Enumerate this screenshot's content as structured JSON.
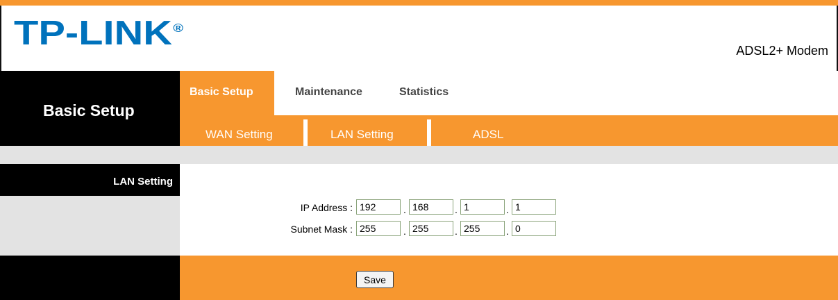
{
  "header": {
    "logo_text": "TP-LINK",
    "logo_mark": "®",
    "product_name": "ADSL2+ Modem"
  },
  "nav": {
    "section_title": "Basic Setup",
    "tabs": [
      {
        "label": "Basic Setup",
        "active": true
      },
      {
        "label": "Maintenance",
        "active": false
      },
      {
        "label": "Statistics",
        "active": false
      }
    ],
    "subnav": [
      {
        "label": "WAN Setting"
      },
      {
        "label": "LAN Setting"
      },
      {
        "label": "ADSL"
      }
    ]
  },
  "content": {
    "section_label": "LAN Setting",
    "ip_address": {
      "label": "IP Address :",
      "octets": [
        "192",
        "168",
        "1",
        "1"
      ]
    },
    "subnet_mask": {
      "label": "Subnet Mask :",
      "octets": [
        "255",
        "255",
        "255",
        "0"
      ]
    },
    "separator": "."
  },
  "footer": {
    "save_label": "Save"
  },
  "colors": {
    "accent": "#f7972f",
    "logo": "#0072bc",
    "panel_dark": "#000000",
    "panel_grey": "#e3e3e3"
  }
}
